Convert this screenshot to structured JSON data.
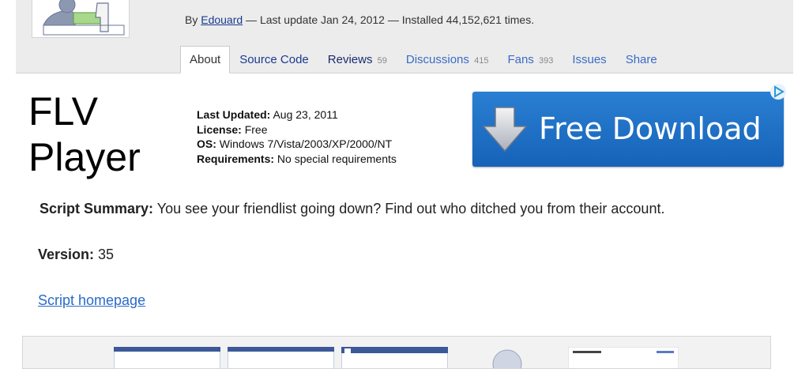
{
  "header": {
    "byline_prefix": "By ",
    "author": "Edouard",
    "byline_suffix": " — Last update Jan 24, 2012 — Installed 44,152,621 times."
  },
  "tabs": [
    {
      "label": "About",
      "count": ""
    },
    {
      "label": "Source Code",
      "count": ""
    },
    {
      "label": "Reviews",
      "count": "59"
    },
    {
      "label": "Discussions",
      "count": "415"
    },
    {
      "label": "Fans",
      "count": "393"
    },
    {
      "label": "Issues",
      "count": ""
    },
    {
      "label": "Share",
      "count": ""
    }
  ],
  "ad": {
    "title_line1": "FLV",
    "title_line2": "Player",
    "last_updated_label": "Last Updated:",
    "last_updated_value": "Aug 23, 2011",
    "license_label": "License:",
    "license_value": "Free",
    "os_label": "OS:",
    "os_value": "Windows 7/Vista/2003/XP/2000/NT",
    "requirements_label": "Requirements:",
    "requirements_value": "No special requirements",
    "button_label": "Free Download",
    "button_color": "#1e6fc5"
  },
  "script": {
    "summary_label": "Script Summary:",
    "summary_text": "You see your friendlist going down? Find out who ditched you from their account.",
    "version_label": "Version:",
    "version_value": "35",
    "homepage_link": "Script homepage"
  },
  "colors": {
    "link": "#1a3a8f",
    "tab_link": "#3a6bc5",
    "header_bg": "#ececec"
  }
}
